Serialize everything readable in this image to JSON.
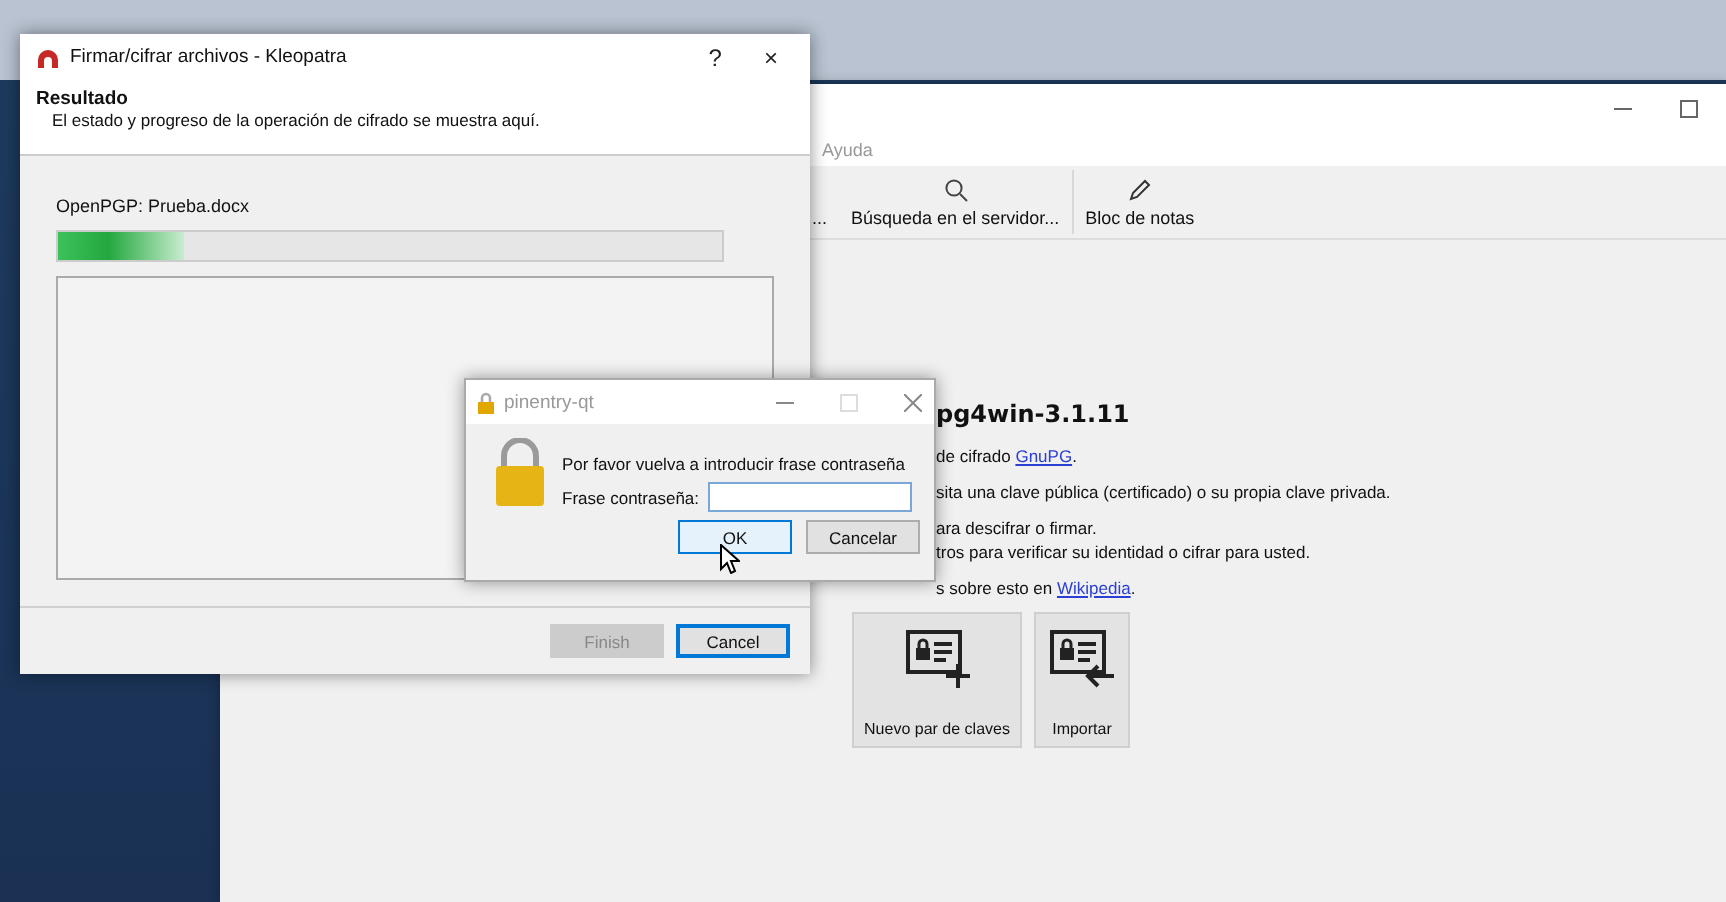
{
  "main_window": {
    "menu": [
      {
        "label": "Ayuda"
      }
    ],
    "toolbar": [
      {
        "label": "...",
        "kind": "none"
      },
      {
        "label": "Búsqueda en el servidor...",
        "kind": "search"
      },
      {
        "label": "Bloc de notas",
        "kind": "notepad"
      }
    ],
    "heading": "pg4win-3.1.11",
    "paragraphs": [
      [
        {
          "text": "de cifrado ",
          "link": "GnuPG",
          "after": "."
        }
      ],
      [
        {
          "text": "sita una clave pública (certificado) o su propia clave privada."
        }
      ],
      [
        {
          "text": "ara descifrar o firmar."
        },
        {
          "text": "tros para verificar su identidad o cifrar para usted."
        }
      ],
      [
        {
          "text": "s sobre esto en ",
          "link": "Wikipedia",
          "after": "."
        }
      ]
    ],
    "actions": [
      {
        "label": "Nuevo par de claves",
        "kind": "new"
      },
      {
        "label": "Importar",
        "kind": "import"
      }
    ]
  },
  "dialog": {
    "title": "Firmar/cifrar archivos - Kleopatra",
    "help": "?",
    "close": "×",
    "header_title": "Resultado",
    "header_subtitle": "El estado y progreso de la operación de cifrado se muestra aquí.",
    "file_label": "OpenPGP: Prueba.docx",
    "progress": {
      "level": 0.19
    },
    "buttons": [
      {
        "label": "Finish",
        "disabled": true,
        "focused": false
      },
      {
        "label": "Cancel",
        "disabled": false,
        "focused": true
      }
    ]
  },
  "pinentry": {
    "title": "pinentry-qt",
    "message": "Por favor vuelva a introducir frase contraseña",
    "field_label": "Frase contraseña:",
    "buttons": [
      {
        "label": "OK",
        "focused": true
      },
      {
        "label": "Cancelar",
        "focused": false
      }
    ]
  }
}
